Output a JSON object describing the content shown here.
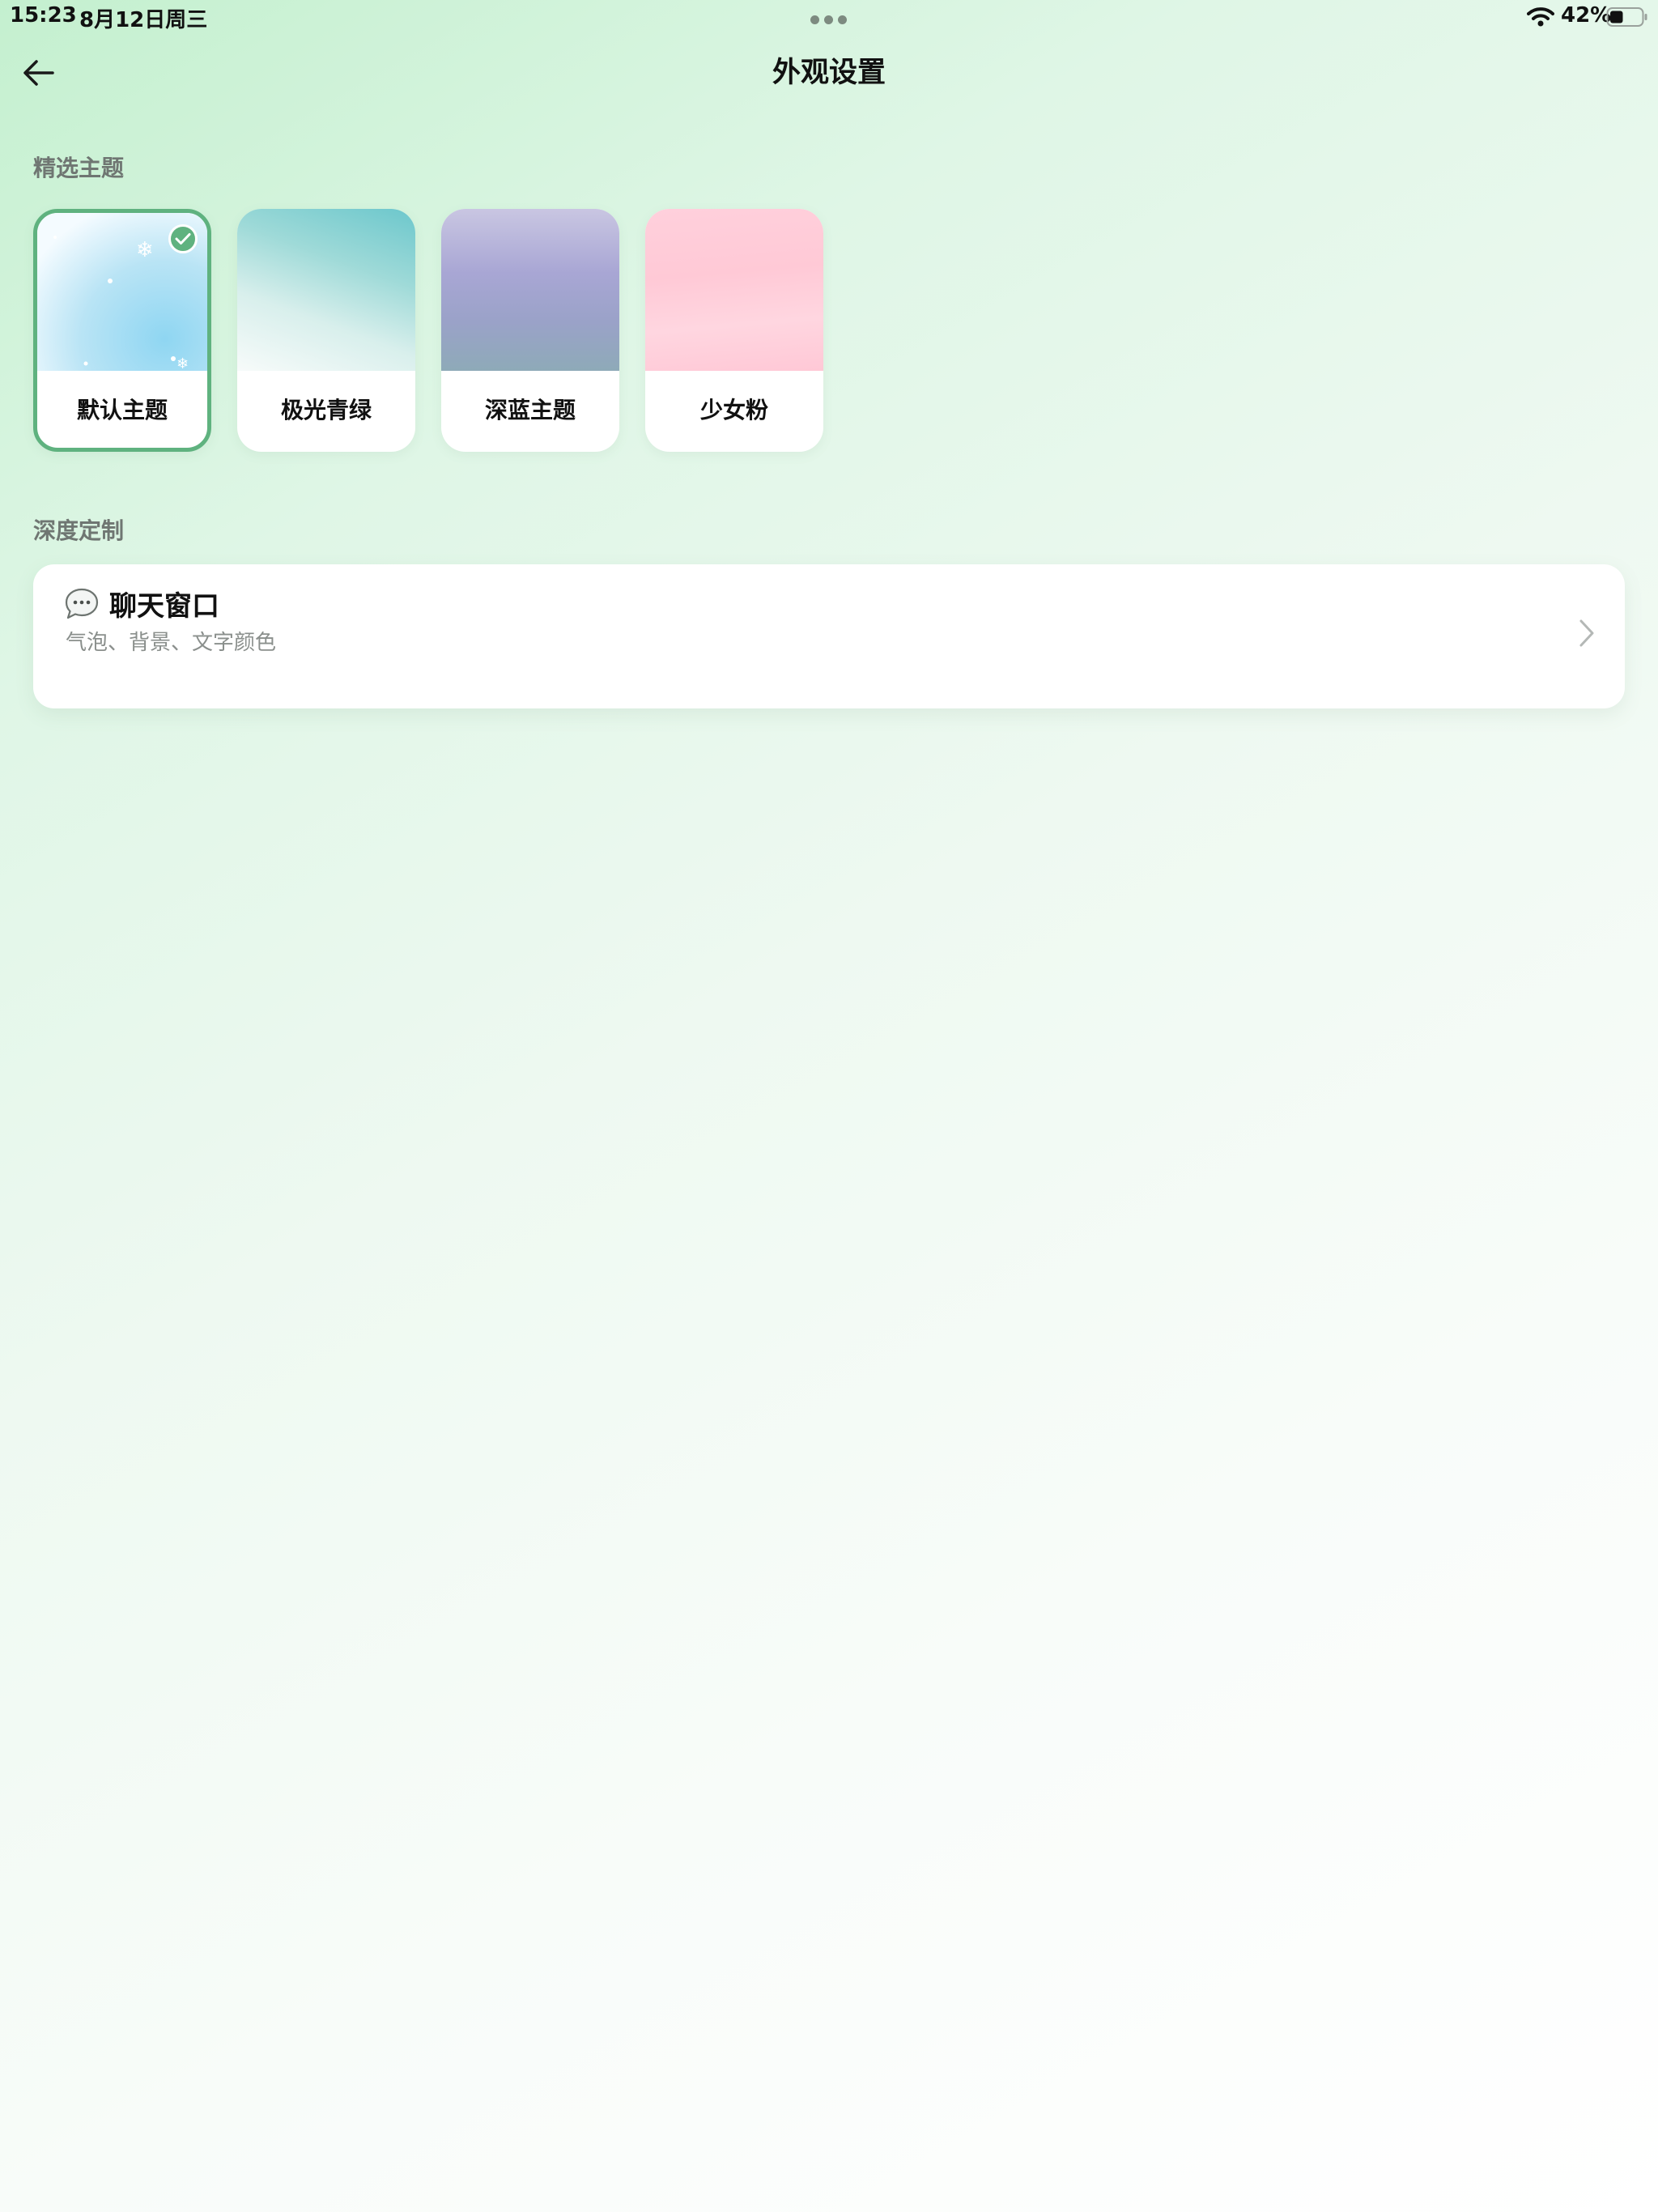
{
  "status_bar": {
    "time": "15:23",
    "date": "8月12日周三",
    "battery_percent": "42%",
    "battery_level": 0.42
  },
  "header": {
    "title": "外观设置",
    "back_icon": "arrow-left-icon"
  },
  "featured_themes": {
    "section_label": "精选主题",
    "items": [
      {
        "label": "默认主题",
        "selected": true
      },
      {
        "label": "极光青绿",
        "selected": false
      },
      {
        "label": "深蓝主题",
        "selected": false
      },
      {
        "label": "少女粉",
        "selected": false
      }
    ]
  },
  "customization": {
    "section_label": "深度定制",
    "chat_window": {
      "icon": "speech-bubble-icon",
      "title": "聊天窗口",
      "subtitle": "气泡、背景、文字颜色"
    }
  },
  "colors": {
    "accent": "#5fb27f",
    "background_top": "#c4f0cf",
    "background_bottom": "#ffffff"
  }
}
